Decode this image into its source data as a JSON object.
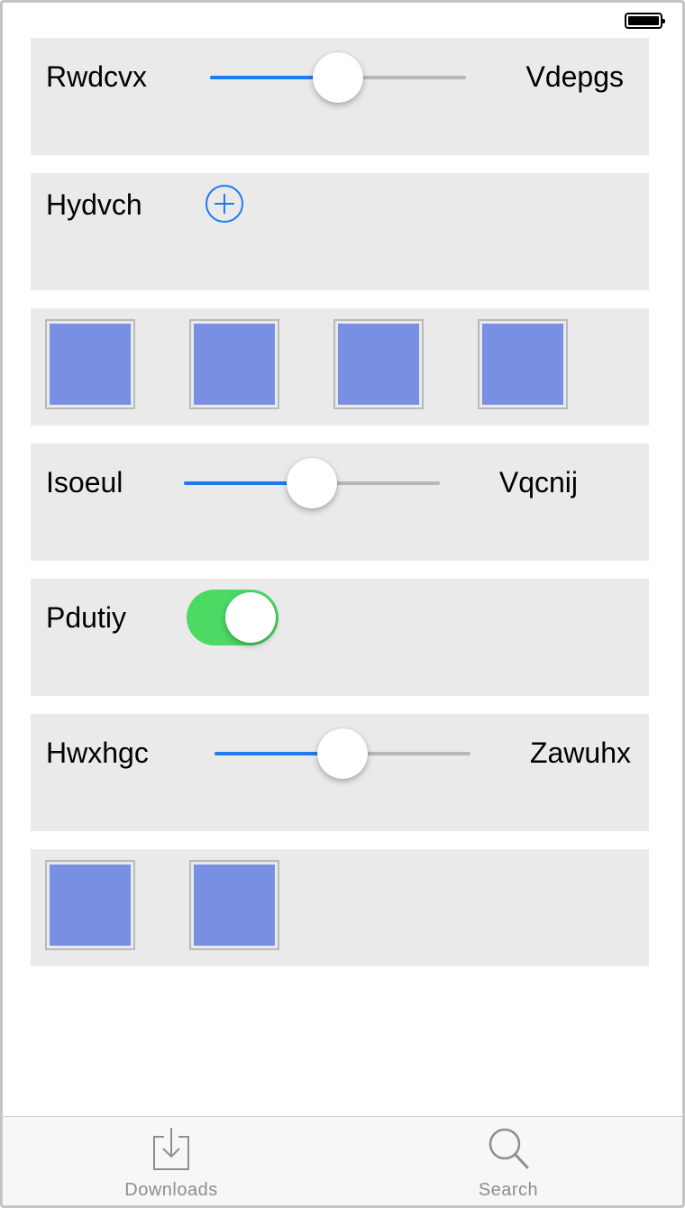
{
  "status_bar": {
    "battery_level": 1.0
  },
  "accent_color": "#1c7cf2",
  "switch_on_color": "#4cd964",
  "image_placeholder_color": "#7790e3",
  "rows": [
    {
      "type": "slider",
      "left_label": "Rwdcvx",
      "right_label": "Vdepgs",
      "value": 0.5
    },
    {
      "type": "add",
      "label": "Hydvch",
      "icon": "plus-circle-icon"
    },
    {
      "type": "images",
      "count": 4
    },
    {
      "type": "slider",
      "left_label": "Isoeul",
      "right_label": "Vqcnij",
      "value": 0.5
    },
    {
      "type": "toggle",
      "label": "Pdutiy",
      "on": true
    },
    {
      "type": "slider",
      "left_label": "Hwxhgc",
      "right_label": "Zawuhx",
      "value": 0.5
    },
    {
      "type": "images",
      "count": 2
    }
  ],
  "tab_bar": {
    "tabs": [
      {
        "label": "Downloads",
        "icon": "download-tray-icon"
      },
      {
        "label": "Search",
        "icon": "magnifier-icon"
      }
    ]
  }
}
